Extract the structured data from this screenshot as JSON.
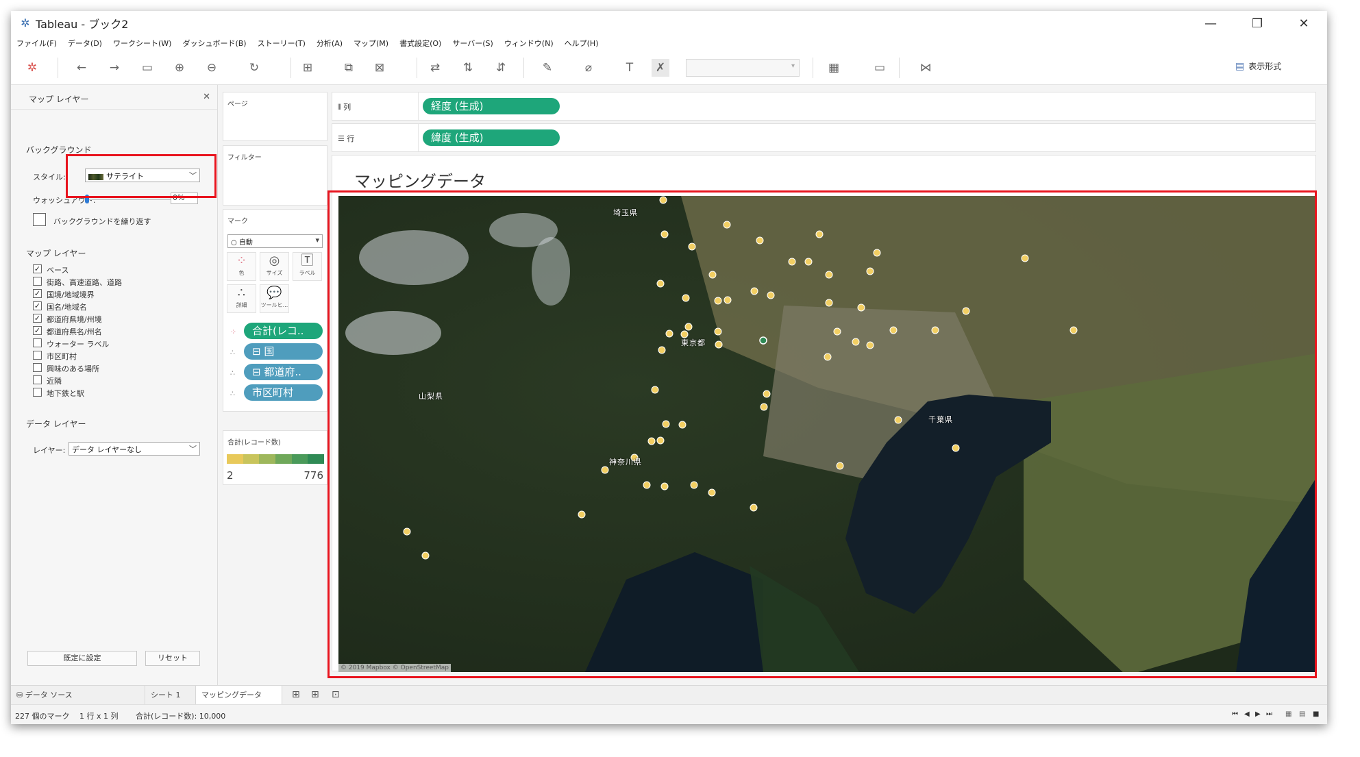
{
  "window": {
    "title": "Tableau - ブック2"
  },
  "menu": [
    "ファイル(F)",
    "データ(D)",
    "ワークシート(W)",
    "ダッシュボード(B)",
    "ストーリー(T)",
    "分析(A)",
    "マップ(M)",
    "書式設定(O)",
    "サーバー(S)",
    "ウィンドウ(N)",
    "ヘルプ(H)"
  ],
  "toolbar": {
    "show_me_label": "表示形式"
  },
  "left_panel": {
    "title": "マップ レイヤー",
    "background_section": "バックグラウンド",
    "style_label": "スタイル:",
    "style_value": "サテライト",
    "washout_label": "ウォッシュアウト:",
    "washout_value": "0%",
    "repeat_background_label": "バックグラウンドを繰り返す",
    "repeat_background_checked": false,
    "map_layers_section": "マップ レイヤー",
    "layers": [
      {
        "label": "ベース",
        "checked": true
      },
      {
        "label": "街路、高速道路、道路",
        "checked": false
      },
      {
        "label": "国境/地域境界",
        "checked": true
      },
      {
        "label": "国名/地域名",
        "checked": true
      },
      {
        "label": "都道府県境/州境",
        "checked": true
      },
      {
        "label": "都道府県名/州名",
        "checked": true
      },
      {
        "label": "ウォーター ラベル",
        "checked": false
      },
      {
        "label": "市区町村",
        "checked": false
      },
      {
        "label": "興味のある場所",
        "checked": false
      },
      {
        "label": "近隣",
        "checked": false
      },
      {
        "label": "地下鉄と駅",
        "checked": false
      }
    ],
    "data_layer_section": "データ レイヤー",
    "layer_label": "レイヤー:",
    "layer_value": "データ レイヤーなし",
    "set_default_button": "既定に設定",
    "reset_button": "リセット"
  },
  "cards": {
    "pages_title": "ページ",
    "filters_title": "フィルター",
    "marks_title": "マーク",
    "mark_type": "自動",
    "mark_buttons": [
      "色",
      "サイズ",
      "ラベル",
      "詳細",
      "ツールヒ..."
    ],
    "mark_pills": [
      "合計(レコ..",
      "国",
      "都道府..",
      "市区町村"
    ],
    "legend_title": "合計(レコード数)",
    "legend_min": "2",
    "legend_max": "776",
    "legend_colors": [
      "#e8c95a",
      "#c8c45c",
      "#9eb75c",
      "#6fa85a",
      "#4a9a5a",
      "#2f8a55"
    ]
  },
  "shelves": {
    "columns_label": "列",
    "columns_pill": "経度 (生成)",
    "rows_label": "行",
    "rows_pill": "緯度 (生成)"
  },
  "view": {
    "title": "マッピングデータ",
    "map_labels": [
      "埼玉県",
      "東京都",
      "山梨県",
      "神奈川県",
      "千葉県"
    ],
    "attribution": "© 2019 Mapbox © OpenStreetMap",
    "point_color": "#f2cf63",
    "highlight_color": "#2f8a55"
  },
  "tabs": {
    "data_source": "データ ソース",
    "sheet1": "シート 1",
    "mapping": "マッピングデータ"
  },
  "status": {
    "marks": "227 個のマーク",
    "rows_cols": "1 行 x 1 列",
    "sum": "合計(レコード数): 10,000"
  }
}
